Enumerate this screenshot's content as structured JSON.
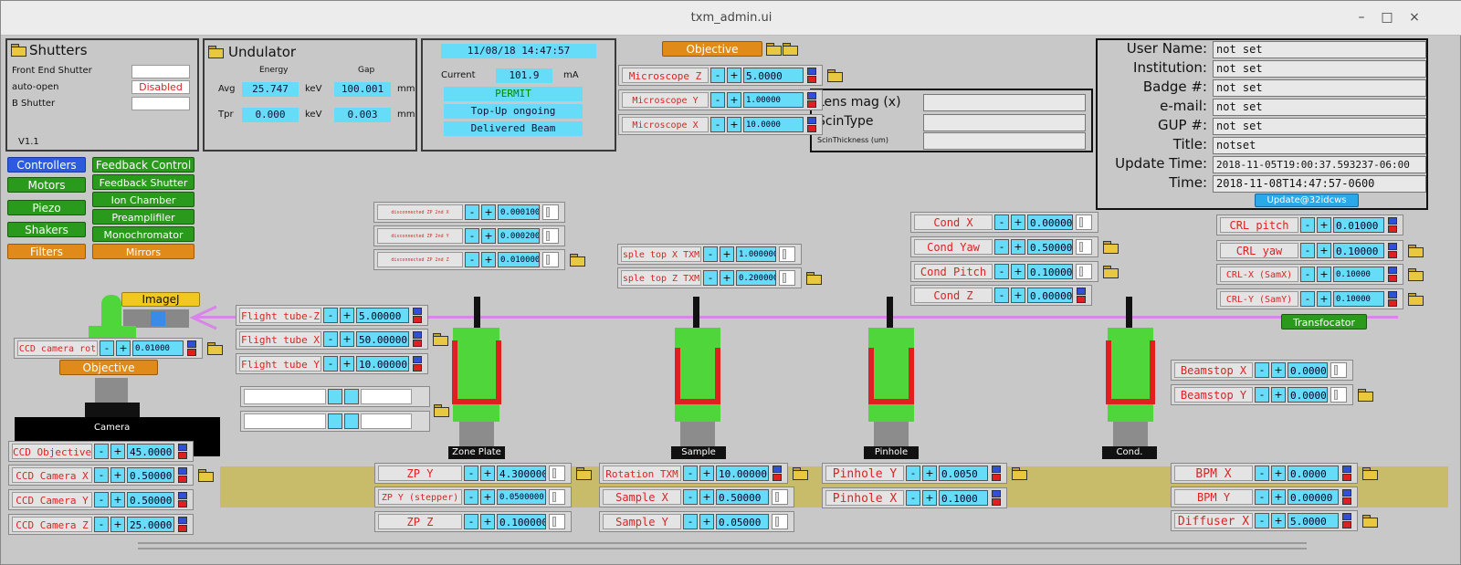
{
  "window": {
    "title": "txm_admin.ui",
    "minimize": "–",
    "maximize": "□",
    "close": "×"
  },
  "shutters": {
    "title": "Shutters",
    "front_end": "Front End Shutter",
    "auto_open": "auto-open",
    "auto_open_value": "Disabled",
    "b_shutter": "B Shutter",
    "version": "V1.1"
  },
  "undulator": {
    "title": "Undulator",
    "energy": "Energy",
    "gap": "Gap",
    "avg": "Avg",
    "avg_energy": "25.747",
    "kev1": "keV",
    "avg_gap": "100.001",
    "mm1": "mm",
    "tpr": "Tpr",
    "tpr_energy": "0.000",
    "kev2": "keV",
    "tpr_gap": "0.003",
    "mm2": "mm"
  },
  "beam": {
    "datetime": "11/08/18 14:47:57",
    "current_label": "Current",
    "current": "101.9",
    "unit": "mA",
    "permit": "PERMIT",
    "topup": "Top-Up ongoing",
    "delivered": "Delivered Beam"
  },
  "nav": {
    "controllers": "Controllers",
    "motors": "Motors",
    "piezo": "Piezo",
    "shakers": "Shakers",
    "filters": "Filters",
    "feedback_control": "Feedback Control",
    "feedback_shutter": "Feedback Shutter",
    "ion_chamber": "Ion Chamber",
    "preamplifier": "Preamplifiler",
    "monochromator": "Monochromator",
    "mirrors": "Mirrors"
  },
  "objective_btn": "Objective",
  "lens": {
    "mag": "Lens mag (x)",
    "scintype": "ScinType",
    "scinthickness": "ScinThickness (um)"
  },
  "user": {
    "rows": [
      {
        "label": "User Name:",
        "value": "not set"
      },
      {
        "label": "Institution:",
        "value": "not set"
      },
      {
        "label": "Badge #:",
        "value": "not set"
      },
      {
        "label": "e-mail:",
        "value": "not set"
      },
      {
        "label": "GUP #:",
        "value": "not set"
      },
      {
        "label": "Title:",
        "value": "notset"
      },
      {
        "label": "Update Time:",
        "value": "2018-11-05T19:00:37.593237-06:00"
      },
      {
        "label": "Time:",
        "value": "2018-11-08T14:47:57-0600"
      }
    ],
    "update_btn": "Update@32idcws"
  },
  "motors": {
    "mz": {
      "name": "Microscope Z",
      "value": "5.0000"
    },
    "my": {
      "name": "Microscope Y",
      "value": "1.00000"
    },
    "mx": {
      "name": "Microscope X",
      "value": "10.0000"
    },
    "zp2x": {
      "name": "disconnected ZP 2nd X",
      "value": "0.000100"
    },
    "zp2y": {
      "name": "disconnected ZP 2nd Y",
      "value": "0.000200"
    },
    "zp2z": {
      "name": "disconnected ZP 2nd Z",
      "value": "0.010000"
    },
    "stx": {
      "name": "sple top X TXM",
      "value": "1.000000"
    },
    "stz": {
      "name": "sple top Z TXM",
      "value": "0.200000"
    },
    "cx": {
      "name": "Cond X",
      "value": "0.000000"
    },
    "cyaw": {
      "name": "Cond Yaw",
      "value": "0.500000"
    },
    "cpitch": {
      "name": "Cond Pitch",
      "value": "0.100000"
    },
    "cz": {
      "name": "Cond Z",
      "value": "0.00000"
    },
    "crlp": {
      "name": "CRL pitch",
      "value": "0.01000"
    },
    "crly": {
      "name": "CRL yaw",
      "value": "0.10000"
    },
    "crlx": {
      "name": "CRL-X (SamX)",
      "value": "0.10000"
    },
    "crlyy": {
      "name": "CRL-Y (SamY)",
      "value": "0.10000"
    },
    "ftz": {
      "name": "Flight tube-Z",
      "value": "5.00000"
    },
    "ftx": {
      "name": "Flight tube X",
      "value": "50.00000"
    },
    "fty": {
      "name": "Flight tube Y",
      "value": "10.00000"
    },
    "ccdrot": {
      "name": "CCD camera rot",
      "value": "0.01000"
    },
    "bsx": {
      "name": "Beamstop X",
      "value": "0.000000"
    },
    "bsy": {
      "name": "Beamstop Y",
      "value": "0.000000"
    },
    "ccdobj": {
      "name": "CCD Objective",
      "value": "45.0000"
    },
    "ccdx": {
      "name": "CCD Camera X",
      "value": "0.50000"
    },
    "ccdy": {
      "name": "CCD Camera Y",
      "value": "0.50000"
    },
    "ccdz": {
      "name": "CCD Camera Z",
      "value": "25.0000"
    },
    "zpy": {
      "name": "ZP Y",
      "value": "4.300000"
    },
    "zpys": {
      "name": "ZP Y (stepper)",
      "value": "0.0500000"
    },
    "zpz": {
      "name": "ZP Z",
      "value": "0.100000"
    },
    "rot": {
      "name": "Rotation TXM",
      "value": "10.00000"
    },
    "sx": {
      "name": "Sample X",
      "value": "0.50000"
    },
    "sy": {
      "name": "Sample Y",
      "value": "0.05000"
    },
    "phy": {
      "name": "Pinhole Y",
      "value": "0.0050"
    },
    "phx": {
      "name": "Pinhole X",
      "value": "0.1000"
    },
    "bpmx": {
      "name": "BPM X",
      "value": "0.0000"
    },
    "bpmy": {
      "name": "BPM Y",
      "value": "0.00000"
    },
    "dfx": {
      "name": "Diffuser X",
      "value": "5.0000"
    }
  },
  "plus": "+",
  "minus": "-",
  "imagej": "ImageJ",
  "objective": "Objective",
  "transfocator": "Transfocator",
  "camera": "Camera",
  "stations": {
    "zone_plate": "Zone Plate",
    "sample": "Sample",
    "pinhole": "Pinhole",
    "cond": "Cond."
  },
  "colors": {
    "beam": "#d884e8",
    "cyan": "#66dcf8",
    "green": "#4fd63a",
    "red": "#e02020",
    "rail": "#c8bc6a"
  }
}
